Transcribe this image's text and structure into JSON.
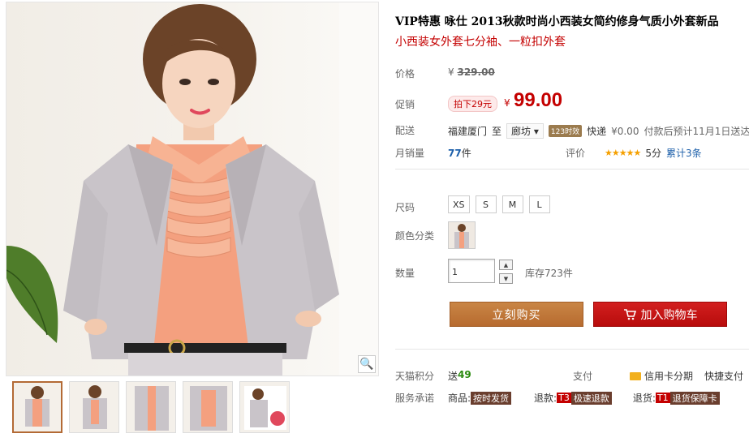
{
  "product": {
    "title": "VIP特惠 咏仕 2013秋款时尚小西装女简约修身气质小外套新品",
    "subtitle": "小西装女外套七分袖、一粒扣外套"
  },
  "price": {
    "label": "价格",
    "currency": "¥",
    "original": "329.00"
  },
  "promo": {
    "label": "促销",
    "badge": "拍下29元",
    "currency": "¥",
    "price": "99.00"
  },
  "shipping": {
    "label": "配送",
    "from": "福建厦门",
    "to_label": "至",
    "to_city": "廊坊",
    "badge": "123时效",
    "method": "快递",
    "fee": "¥0.00",
    "note": "付款后预计11月1日送达"
  },
  "sales": {
    "label": "月销量",
    "count": "77",
    "unit": "件"
  },
  "rating": {
    "label": "评价",
    "stars": "★★★★★",
    "score": "5分",
    "total": "累计3条"
  },
  "size": {
    "label": "尺码",
    "options": [
      "XS",
      "S",
      "M",
      "L"
    ]
  },
  "color": {
    "label": "颜色分类"
  },
  "quantity": {
    "label": "数量",
    "value": "1",
    "stock": "库存723件"
  },
  "buttons": {
    "buy": "立刻购买",
    "cart": "加入购物车"
  },
  "tmall": {
    "label": "天猫积分",
    "prefix": "送",
    "points": "49"
  },
  "payment": {
    "label": "支付",
    "credit": "信用卡分期",
    "quick": "快捷支付"
  },
  "service": {
    "label": "服务承诺",
    "goods": "商品:",
    "goods_tag": "按时发货",
    "refund": "退款:",
    "refund_code": "T3",
    "refund_tag": "极速退款",
    "return": "退货:",
    "return_code": "T1",
    "return_tag": "退货保障卡"
  },
  "colors": {
    "accent_red": "#c40000",
    "buy_button": "#c07a3c",
    "cart_button": "#c81414",
    "link_blue": "#1c5faa",
    "points_green": "#2a8a0e"
  }
}
